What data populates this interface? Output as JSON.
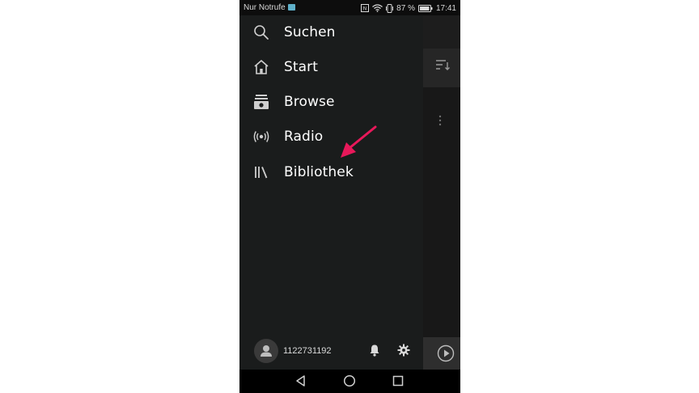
{
  "status_bar": {
    "carrier": "Nur Notrufe",
    "battery_percent": "87 %",
    "time": "17:41",
    "icons": [
      "sim-icon",
      "nfc-icon",
      "wifi-icon",
      "vibrate-icon",
      "battery-icon"
    ]
  },
  "drawer": {
    "items": [
      {
        "label": "Suchen",
        "icon": "search-icon"
      },
      {
        "label": "Start",
        "icon": "home-icon"
      },
      {
        "label": "Browse",
        "icon": "browse-icon"
      },
      {
        "label": "Radio",
        "icon": "radio-icon"
      },
      {
        "label": "Bibliothek",
        "icon": "library-icon"
      }
    ],
    "footer": {
      "username": "1122731192",
      "icons": [
        "avatar-icon",
        "bell-icon",
        "gear-icon"
      ]
    }
  },
  "background_app": {
    "icons": [
      "sort-icon",
      "more-options-icon",
      "play-icon"
    ]
  },
  "nav_bar": {
    "icons": [
      "back-icon",
      "home-button-icon",
      "recents-icon"
    ]
  },
  "annotation": {
    "icon": "arrow-annotation",
    "color": "#e8185a"
  },
  "colors": {
    "drawer_bg": "#1a1c1c",
    "text": "#ffffff",
    "accent_arrow": "#e8185a"
  }
}
